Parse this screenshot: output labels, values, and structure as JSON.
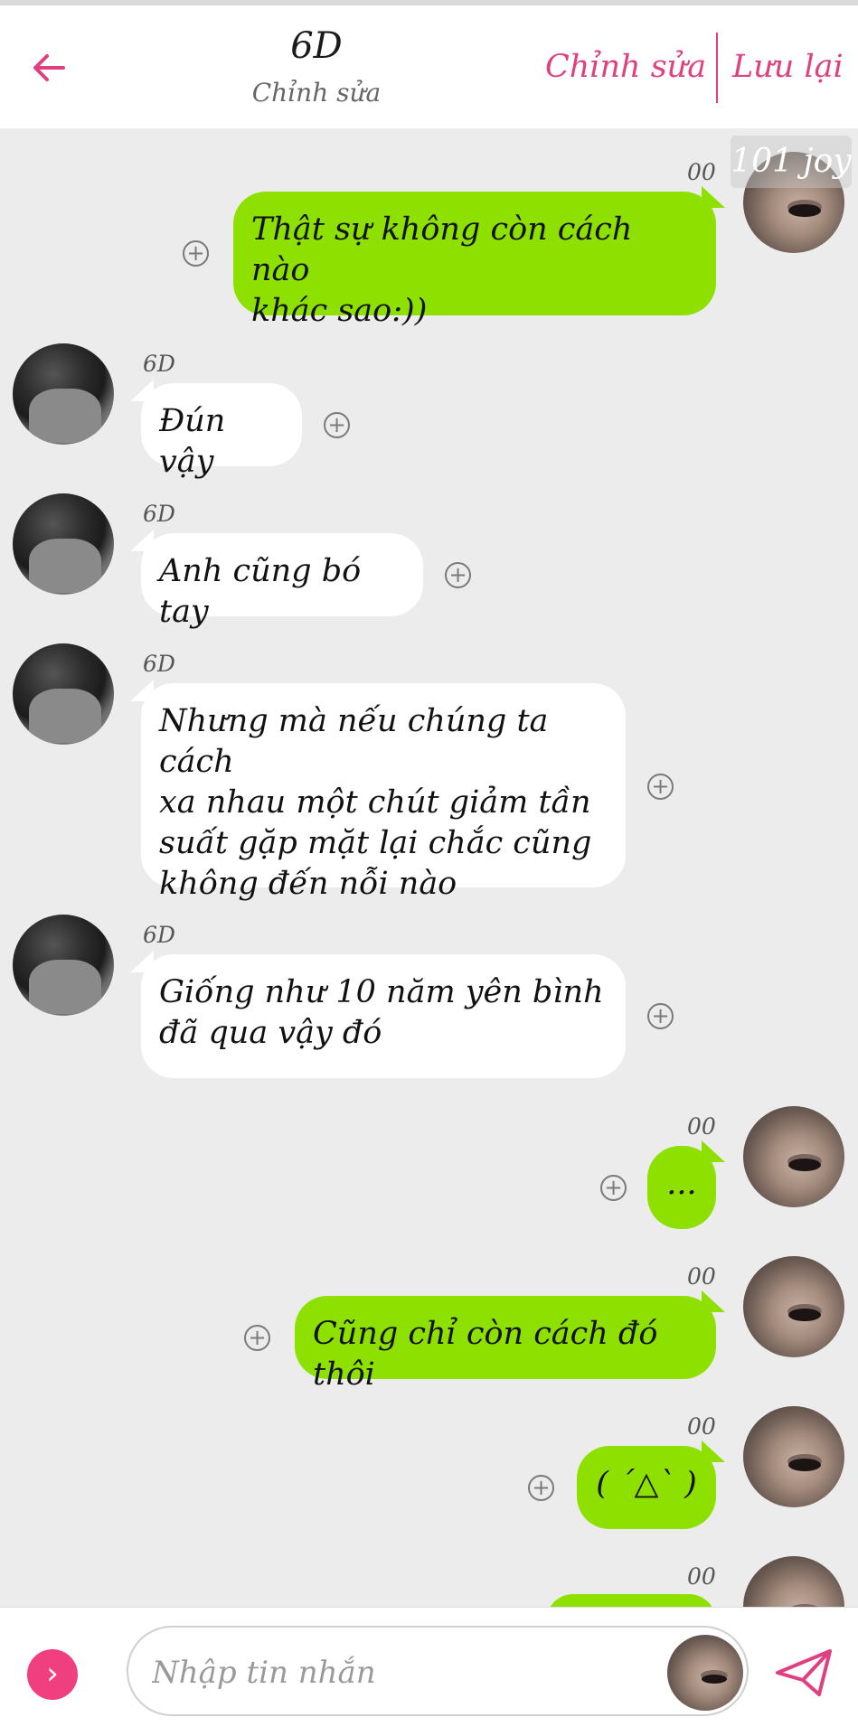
{
  "header": {
    "title": "6D",
    "subtitle": "Chỉnh sửa",
    "edit_label": "Chỉnh sửa",
    "save_label": "Lưu lại"
  },
  "watermark": "101 joy",
  "messages": [
    {
      "sender": "00",
      "side": "out",
      "text_lines": [
        "Thật sự không còn cách nào",
        "khác sao:))"
      ]
    },
    {
      "sender": "6D",
      "side": "in",
      "text_lines": [
        "Đún vậy"
      ]
    },
    {
      "sender": "6D",
      "side": "in",
      "text_lines": [
        "Anh cũng bó tay"
      ]
    },
    {
      "sender": "6D",
      "side": "in",
      "text_lines": [
        "Nhưng mà nếu chúng ta cách",
        "xa nhau một chút giảm tần",
        "suất gặp mặt lại chắc cũng",
        "không đến nỗi nào"
      ]
    },
    {
      "sender": "6D",
      "side": "in",
      "text_lines": [
        "Giống như 10 năm yên bình",
        "đã qua vậy đó"
      ]
    },
    {
      "sender": "00",
      "side": "out",
      "text_lines": [
        "..."
      ]
    },
    {
      "sender": "00",
      "side": "out",
      "text_lines": [
        "Cũng chỉ còn cách đó thôi"
      ]
    },
    {
      "sender": "00",
      "side": "out",
      "text_lines": [
        "( ´△` )"
      ]
    },
    {
      "sender": "00",
      "side": "out",
      "text_lines": [
        ""
      ]
    }
  ],
  "composer": {
    "placeholder": "Nhập tin nhắn"
  },
  "colors": {
    "accent": "#e0407f",
    "outgoing_bubble": "#8ee000",
    "incoming_bubble": "#ffffff",
    "background": "#ececec"
  },
  "icons": {
    "back": "arrow-left-icon",
    "add_reaction": "plus-circle-icon",
    "expand": "chevron-right-icon",
    "send": "paper-plane-icon"
  }
}
